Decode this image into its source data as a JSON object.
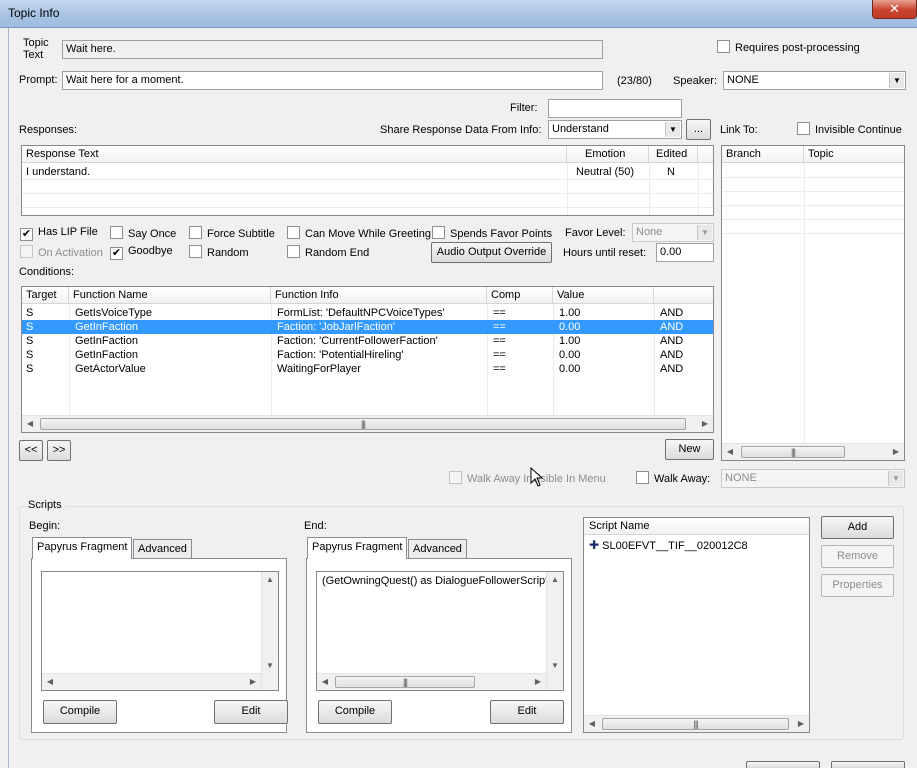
{
  "window": {
    "title": "Topic Info",
    "close_glyph": "✕"
  },
  "topic": {
    "label_line1": "Topic",
    "label_line2": "Text",
    "value": "Wait here."
  },
  "requires_post_processing": {
    "label": "Requires post-processing",
    "checked": false
  },
  "prompt": {
    "label": "Prompt:",
    "value": "Wait here for a moment.",
    "count": "(23/80)"
  },
  "speaker": {
    "label": "Speaker:",
    "value": "NONE"
  },
  "filter": {
    "label": "Filter:",
    "value": ""
  },
  "responses": {
    "label": "Responses:",
    "share_label": "Share Response Data From Info:",
    "share_value": "Understand",
    "ellipsis": "...",
    "columns": [
      "Response Text",
      "Emotion",
      "Edited"
    ],
    "rows": [
      {
        "text": "I understand.",
        "emotion": "Neutral (50)",
        "edited": "N"
      }
    ]
  },
  "link_to": {
    "label": "Link To:",
    "invisible_continue": "Invisible Continue",
    "columns": [
      "Branch",
      "Topic"
    ]
  },
  "flags": {
    "has_lip_file": {
      "label": "Has LIP File",
      "checked": true
    },
    "say_once": {
      "label": "Say Once",
      "checked": false
    },
    "force_subtitle": {
      "label": "Force Subtitle",
      "checked": false
    },
    "can_move_while_greeting": {
      "label": "Can Move While Greeting",
      "checked": false
    },
    "spends_favor_points": {
      "label": "Spends Favor Points",
      "checked": false
    },
    "on_activation": {
      "label": "On Activation",
      "checked": false
    },
    "goodbye": {
      "label": "Goodbye",
      "checked": true
    },
    "random": {
      "label": "Random",
      "checked": false
    },
    "random_end": {
      "label": "Random End",
      "checked": false
    }
  },
  "favor_level": {
    "label": "Favor Level:",
    "value": "None"
  },
  "audio_output_override": "Audio Output Override",
  "hours_until_reset": {
    "label": "Hours until reset:",
    "value": "0.00"
  },
  "conditions": {
    "label": "Conditions:",
    "columns": [
      "Target",
      "Function Name",
      "Function Info",
      "Comp",
      "Value",
      ""
    ],
    "rows": [
      {
        "target": "S",
        "function": "GetIsVoiceType",
        "info": "FormList: 'DefaultNPCVoiceTypes'",
        "comp": "==",
        "value": "1.00",
        "op": "AND",
        "selected": false
      },
      {
        "target": "S",
        "function": "GetInFaction",
        "info": "Faction: 'JobJarlFaction'",
        "comp": "==",
        "value": "0.00",
        "op": "AND",
        "selected": true
      },
      {
        "target": "S",
        "function": "GetInFaction",
        "info": "Faction: 'CurrentFollowerFaction'",
        "comp": "==",
        "value": "1.00",
        "op": "AND",
        "selected": false
      },
      {
        "target": "S",
        "function": "GetInFaction",
        "info": "Faction: 'PotentialHireling'",
        "comp": "==",
        "value": "0.00",
        "op": "AND",
        "selected": false
      },
      {
        "target": "S",
        "function": "GetActorValue",
        "info": "WaitingForPlayer",
        "comp": "==",
        "value": "0.00",
        "op": "AND",
        "selected": false
      }
    ]
  },
  "nav": {
    "prev": "<<",
    "next": ">>",
    "new": "New"
  },
  "walk_away": {
    "invisible_label": "Walk Away Invisible In Menu",
    "label": "Walk Away:",
    "value": "NONE"
  },
  "scripts": {
    "title": "Scripts",
    "begin_label": "Begin:",
    "end_label": "End:",
    "tab_fragment": "Papyrus Fragment",
    "tab_advanced": "Advanced",
    "begin_text": "",
    "end_text": "(GetOwningQuest() as DialogueFollowerScript",
    "compile": "Compile",
    "edit": "Edit",
    "list_header": "Script Name",
    "items": [
      "SL00EFVT__TIF__020012C8"
    ],
    "add": "Add",
    "remove": "Remove",
    "properties": "Properties"
  },
  "icons": {
    "combo_arrow": "▼",
    "scroll_left": "◀",
    "scroll_right": "▶",
    "scroll_up": "▲",
    "scroll_down": "▼",
    "grip": "|||",
    "check": "✔",
    "plus": "✚"
  }
}
